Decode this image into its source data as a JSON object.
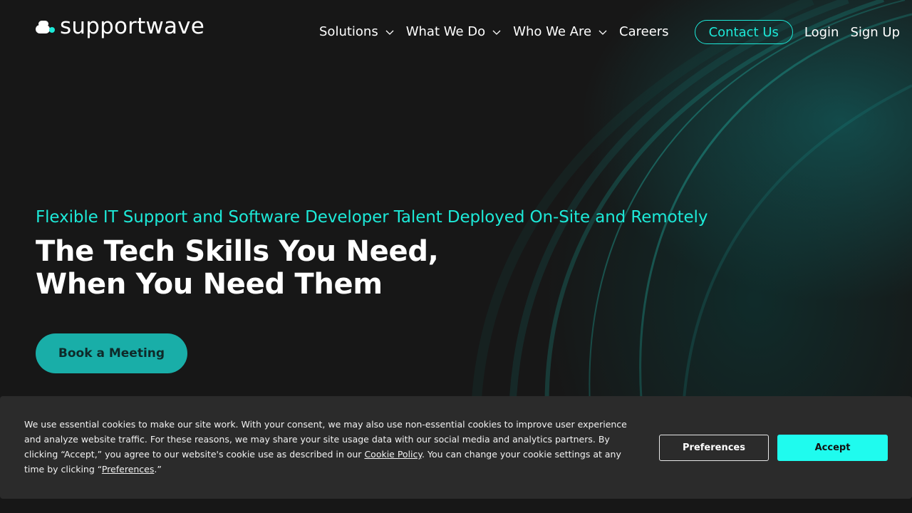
{
  "brand": {
    "name": "supportwave",
    "accent_color": "#1de9d8",
    "logo_icon": "supportwave-logo-icon"
  },
  "nav": {
    "items": [
      {
        "label": "Solutions",
        "icon": "chevron-down-icon"
      },
      {
        "label": "What We Do",
        "icon": "chevron-down-icon"
      },
      {
        "label": "Who We Are",
        "icon": "chevron-down-icon"
      },
      {
        "label": "Careers"
      }
    ],
    "contact_label": "Contact Us",
    "login_label": "Login",
    "signup_label": "Sign Up"
  },
  "hero": {
    "subtitle": "Flexible IT Support and Software Developer Talent Deployed On-Site and Remotely",
    "headline_line1": "The Tech Skills You Need,",
    "headline_line2": "When You Need Them",
    "cta_label": "Book a Meeting",
    "cta_color": "#19aea8"
  },
  "cookie_banner": {
    "text_part1": "We use essential cookies to make our site work. With your consent, we may also use non-essential cookies to improve user experience and analyze website traffic. For these reasons, we may share your site usage data with our social media and analytics partners. By clicking “Accept,” you agree to our website's cookie use as described in our ",
    "policy_link": "Cookie Policy",
    "text_part2": ". You can change your cookie settings at any time by clicking “",
    "preferences_link": "Preferences",
    "text_part3": ".”",
    "preferences_button": "Preferences",
    "accept_button": "Accept",
    "accept_color": "#1ffbee"
  }
}
